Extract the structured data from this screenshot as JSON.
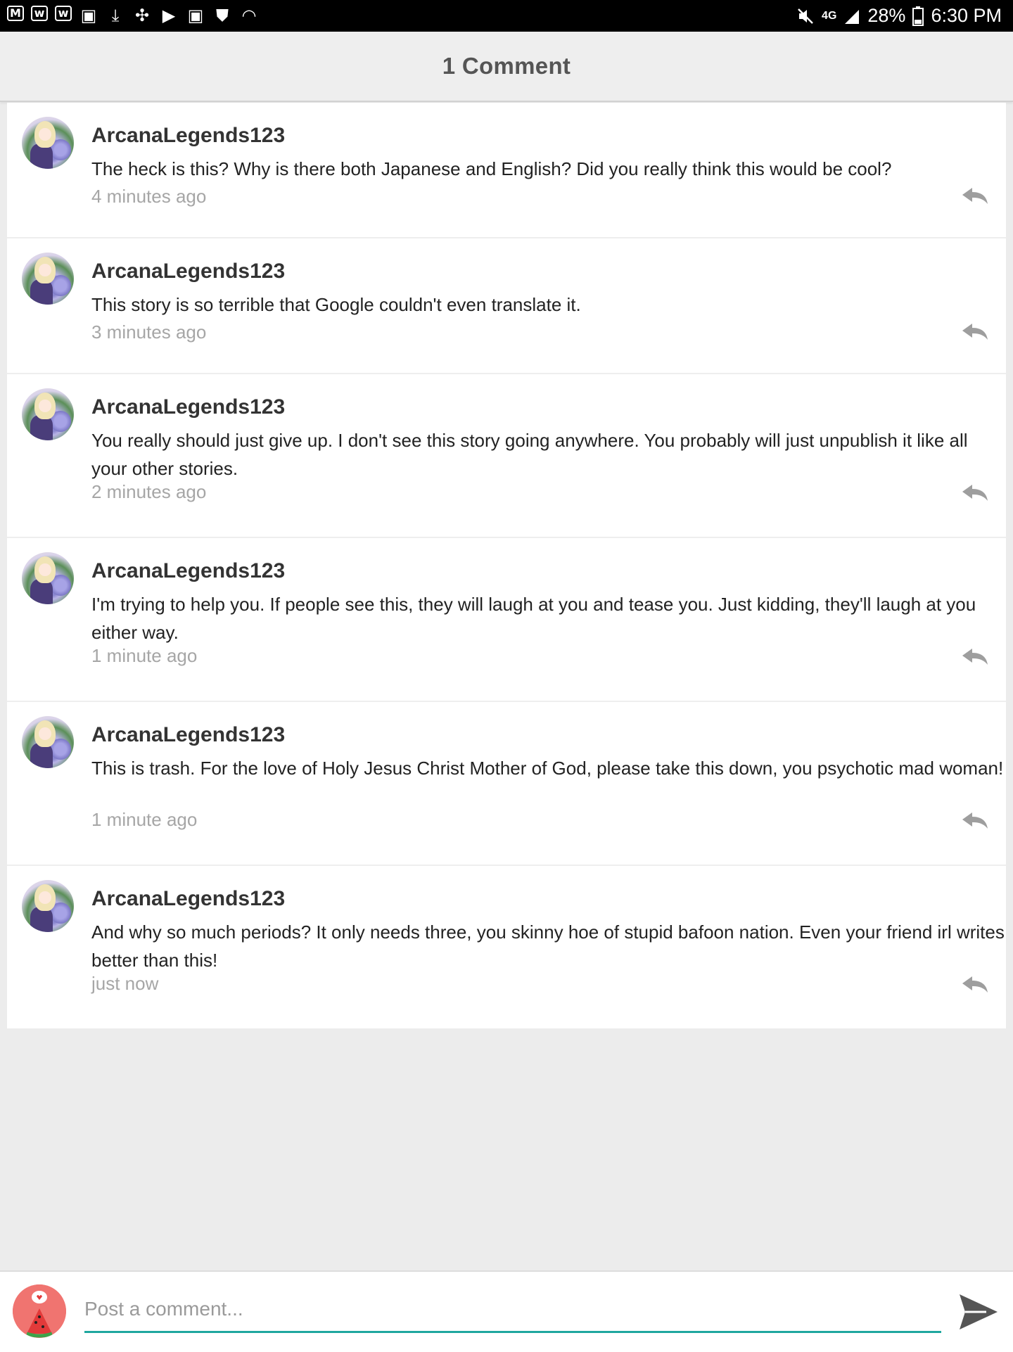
{
  "status_bar": {
    "battery": "28%",
    "time": "6:30 PM",
    "network": "4G"
  },
  "header": {
    "title": "1 Comment"
  },
  "comments": [
    {
      "username": "ArcanaLegends123",
      "text": "The heck is this? Why is there both Japanese and English? Did you really think this would be cool?",
      "time": "4 minutes ago"
    },
    {
      "username": "ArcanaLegends123",
      "text": "This story is so terrible that Google couldn't even translate it.",
      "time": "3 minutes ago"
    },
    {
      "username": "ArcanaLegends123",
      "text": "You really should just give up. I don't see this story going anywhere. You probably will just unpublish it like all your other stories.",
      "time": "2 minutes ago"
    },
    {
      "username": "ArcanaLegends123",
      "text": "I'm trying to help you. If people see this, they will laugh at you and tease you. Just kidding, they'll laugh at you either way.",
      "time": "1 minute ago"
    },
    {
      "username": "ArcanaLegends123",
      "text": "This is trash. For the love of Holy Jesus Christ Mother of God, please take this down, you psychotic mad woman!",
      "time": "1 minute ago"
    },
    {
      "username": "ArcanaLegends123",
      "text": "And why so much periods? It only needs three, you skinny hoe of stupid bafoon nation. Even your friend irl writes better than this!",
      "time": "just now"
    }
  ],
  "composer": {
    "placeholder": "Post a comment..."
  },
  "colors": {
    "accent": "#1fa79f",
    "icon_gray": "#9e9e9e"
  }
}
